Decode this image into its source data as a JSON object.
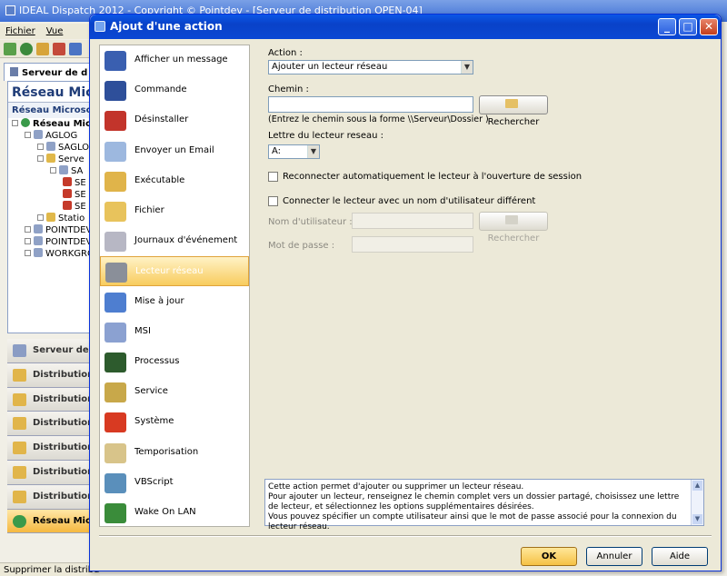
{
  "background_app": {
    "title": "IDEAL Dispatch 2012 - Copyright © Pointdev - [Serveur de distribution OPEN-04]",
    "menu": [
      "Fichier",
      "Vue"
    ],
    "tab_label": "Serveur de d",
    "panel_title": "Réseau Micro",
    "panel_subtitle": "Réseau Microsoft",
    "tree": [
      "Réseau Micr",
      "AGLOG",
      "SAGLO",
      "Serve",
      "SA",
      "SE",
      "SE",
      "SE",
      "Statio",
      "POINTDEV",
      "POINTDEV",
      "WORKGRO"
    ],
    "nav_buttons": [
      "Serveur de d",
      "Distributions",
      "Distributions",
      "Distributions",
      "Distributions",
      "Distributions",
      "Distributions",
      "Réseau Micro"
    ],
    "status": "Supprimer la distribution"
  },
  "dialog": {
    "title": "Ajout d'une action",
    "actions": [
      {
        "label": "Afficher un message",
        "icon": "message-icon",
        "color": "#3a5fb0"
      },
      {
        "label": "Commande",
        "icon": "command-icon",
        "color": "#2e4f9a"
      },
      {
        "label": "Désinstaller",
        "icon": "uninstall-icon",
        "color": "#c2342b"
      },
      {
        "label": "Envoyer un Email",
        "icon": "email-icon",
        "color": "#9db8df"
      },
      {
        "label": "Exécutable",
        "icon": "executable-icon",
        "color": "#e0b44a"
      },
      {
        "label": "Fichier",
        "icon": "file-icon",
        "color": "#e8c35c"
      },
      {
        "label": "Journaux d'événement",
        "icon": "event-log-icon",
        "color": "#b7b7c4"
      },
      {
        "label": "Lecteur réseau",
        "icon": "network-drive-icon",
        "color": "#8a8f99"
      },
      {
        "label": "Mise à jour",
        "icon": "update-icon",
        "color": "#4e7ed0"
      },
      {
        "label": "MSI",
        "icon": "msi-icon",
        "color": "#8ba1d1"
      },
      {
        "label": "Processus",
        "icon": "process-icon",
        "color": "#2d5b2d"
      },
      {
        "label": "Service",
        "icon": "service-icon",
        "color": "#c8a84a"
      },
      {
        "label": "Système",
        "icon": "system-icon",
        "color": "#d83a22"
      },
      {
        "label": "Temporisation",
        "icon": "hourglass-icon",
        "color": "#d8c48a"
      },
      {
        "label": "VBScript",
        "icon": "vbscript-icon",
        "color": "#5a8fbb"
      },
      {
        "label": "Wake On LAN",
        "icon": "wake-on-lan-icon",
        "color": "#3a8c3a"
      }
    ],
    "selected_action": "Lecteur réseau",
    "form": {
      "action_label": "Action :",
      "action_value": "Ajouter un lecteur réseau",
      "chemin_label": "Chemin :",
      "chemin_value": "",
      "rechercher": "Rechercher",
      "chemin_hint": "(Entrez le chemin sous la forme \\\\Serveur\\Dossier )",
      "lettre_label": "Lettre du lecteur reseau :",
      "lettre_value": "A:",
      "reconnect_label": "Reconnecter automatiquement le lecteur à l'ouverture de session",
      "reconnect_checked": false,
      "other_user_label": "Connecter le lecteur avec un nom d'utilisateur différent",
      "other_user_checked": false,
      "username_label": "Nom d'utilisateur :",
      "password_label": "Mot de passe :"
    },
    "description": "Cette action permet d'ajouter ou supprimer un lecteur réseau.\nPour ajouter un lecteur, renseignez le chemin complet vers un dossier partagé, choisissez une lettre de lecteur, et sélectionnez les options supplémentaires désirées.\nVous pouvez spécifier un compte utilisateur ainsi que le mot de passe associé pour la connexion du lecteur réseau.",
    "buttons": {
      "ok": "OK",
      "cancel": "Annuler",
      "help": "Aide"
    }
  }
}
